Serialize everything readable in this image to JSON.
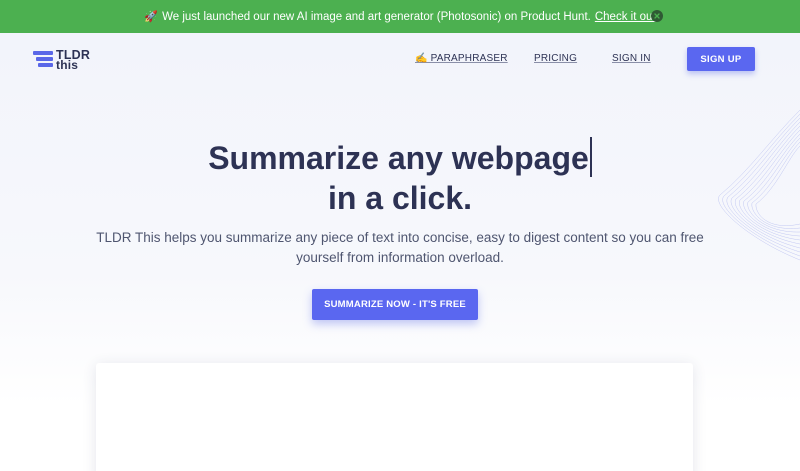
{
  "banner": {
    "icon": "rocket-icon",
    "text": "We just launched our new AI image and art generator (Photosonic) on Product Hunt.",
    "link_text": "Check it out",
    "background": "#4cb050"
  },
  "header": {
    "logo_line1": "TLDR",
    "logo_line2": "this",
    "nav": {
      "paraphraser": "✍️ PARAPHRASER",
      "pricing": "PRICING",
      "signin": "SIGN IN"
    },
    "signup_label": "SIGN UP"
  },
  "hero": {
    "headline_line1": "Summarize any webpage",
    "headline_line2": "in a click.",
    "subtext": "TLDR This helps you summarize any piece of text into concise, easy to digest content so you can free yourself from information overload.",
    "cta_label": "SUMMARIZE NOW - IT'S FREE"
  },
  "colors": {
    "accent": "#5a67f0",
    "heading": "#2d3254"
  }
}
